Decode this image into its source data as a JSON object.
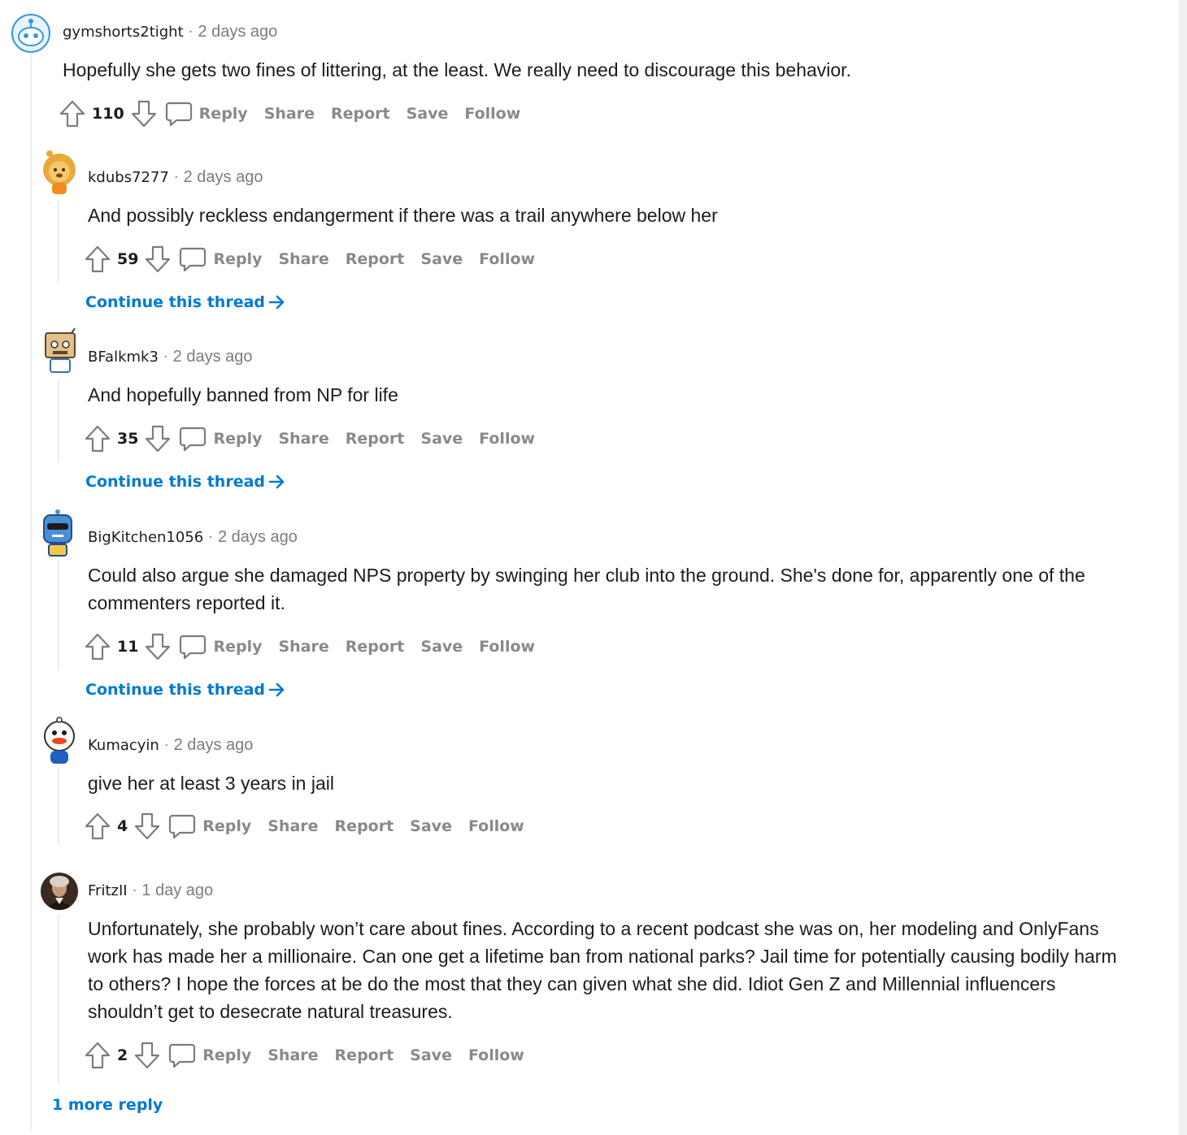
{
  "comments": [
    {
      "username": "gymshorts2tight",
      "time": "2 days ago",
      "body": "Hopefully she gets two fines of littering, at the least. We really need to discourage this behavior.",
      "score": "110",
      "avatar": "snoo-avatar-default"
    },
    {
      "username": "kdubs7277",
      "time": "2 days ago",
      "body": "And possibly reckless endangerment if there was a trail anywhere below her",
      "score": "59",
      "continue_label": "Continue this thread",
      "avatar": "snoo-avatar-lion"
    },
    {
      "username": "BFalkmk3",
      "time": "2 days ago",
      "body": "And hopefully banned from NP for life",
      "score": "35",
      "continue_label": "Continue this thread",
      "avatar": "snoo-avatar-box-robot"
    },
    {
      "username": "BigKitchen1056",
      "time": "2 days ago",
      "body": "Could also argue she damaged NPS property by swinging her club into the ground. She's done for, apparently one of the commenters reported it.",
      "score": "11",
      "continue_label": "Continue this thread",
      "avatar": "snoo-avatar-sunglasses"
    },
    {
      "username": "Kumacyin",
      "time": "2 days ago",
      "body": "give her at least 3 years in jail",
      "score": "4",
      "avatar": "snoo-avatar-duck"
    },
    {
      "username": "FritzII",
      "time": "1 day ago",
      "body": "Unfortunately, she probably won’t care about fines. According to a recent podcast she was on, her modeling and OnlyFans work has made her a millionaire. Can one get a lifetime ban from national parks? Jail time for potentially causing bodily harm to others? I hope the forces at be do the most that they can given what she did. Idiot Gen Z and Millennial influencers shouldn’t get to desecrate natural treasures.",
      "score": "2",
      "avatar": "portrait-avatar"
    }
  ],
  "actions": {
    "reply": "Reply",
    "share": "Share",
    "report": "Report",
    "save": "Save",
    "follow": "Follow"
  },
  "separator": "·",
  "more_replies": "1 more reply",
  "icons": {
    "upvote": "upvote-arrow-icon",
    "downvote": "downvote-arrow-icon",
    "reply": "comment-bubble-icon",
    "continue": "arrow-right-icon"
  },
  "colors": {
    "link": "#0079d3",
    "muted": "#878a8c",
    "text": "#1c1c1c"
  }
}
